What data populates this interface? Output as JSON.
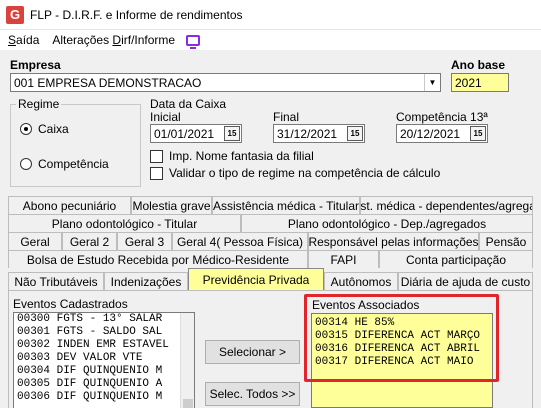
{
  "window": {
    "title": "FLP - D.I.R.F. e Informe de rendimentos",
    "icon_letter": "G"
  },
  "menu": {
    "items": [
      {
        "pre": "",
        "u": "S",
        "post": "aída"
      },
      {
        "pre": "Alterações ",
        "u": "D",
        "post": "irf/Informe"
      }
    ]
  },
  "empresa": {
    "label": "Empresa",
    "value": "001 EMPRESA DEMONSTRACAO"
  },
  "ano_base": {
    "label": "Ano base",
    "value": "2021"
  },
  "regime": {
    "title": "Regime",
    "options": [
      "Caixa",
      "Competência"
    ],
    "selected": "Caixa"
  },
  "data_caixa": {
    "title": "Data da Caixa",
    "inicial_label": "Inicial",
    "inicial": "01/01/2021",
    "final_label": "Final",
    "final": "31/12/2021",
    "comp13_label": "Competência 13ª",
    "comp13": "20/12/2021"
  },
  "checks": {
    "fantasia": "Imp. Nome fantasia da filial",
    "validar": "Validar o tipo de regime na competência de cálculo"
  },
  "tab_rows": [
    [
      "Abono pecuniário",
      "Molestia grave",
      "Assistência médica - Titular",
      "Assist. médica - dependentes/agregados"
    ],
    [
      "Plano odontológico - Titular",
      "Plano odontológico - Dep./agregados"
    ],
    [
      "Geral",
      "Geral 2",
      "Geral 3",
      "Geral 4( Pessoa Física)",
      "Responsável pelas informações",
      "Pensão"
    ],
    [
      "Bolsa de Estudo Recebida por Médico-Residente",
      "FAPI",
      "Conta participação"
    ],
    [
      "Não Tributáveis",
      "Indenizações",
      "Previdência Privada",
      "Autônomos",
      "Diária de ajuda de custo"
    ]
  ],
  "active_tab": "Previdência Privada",
  "eventos_cadastrados": {
    "label": "Eventos Cadastrados",
    "items": [
      "00300 FGTS - 13° SALAR",
      "00301 FGTS - SALDO SAL",
      "00302 INDEN EMR ESTAVEL",
      "00303 DEV VALOR VTE",
      "00304 DIF QUINQUENIO M",
      "00305 DIF QUINQUENIO A",
      "00306 DIF QUINQUENIO M"
    ]
  },
  "eventos_associados": {
    "label": "Eventos Associados",
    "items": [
      "00314 HE 85%",
      "00315 DIFERENCA ACT MARÇO",
      "00316 DIFERENCA ACT ABRIL",
      "00317 DIFERENCA ACT MAIO"
    ]
  },
  "buttons": {
    "selecionar": "Selecionar >",
    "selec_todos": "Selec. Todos >>"
  },
  "colors": {
    "highlight": "#ffff99",
    "annotation_border": "#e0262a"
  },
  "icons": {
    "calendar": "15"
  }
}
